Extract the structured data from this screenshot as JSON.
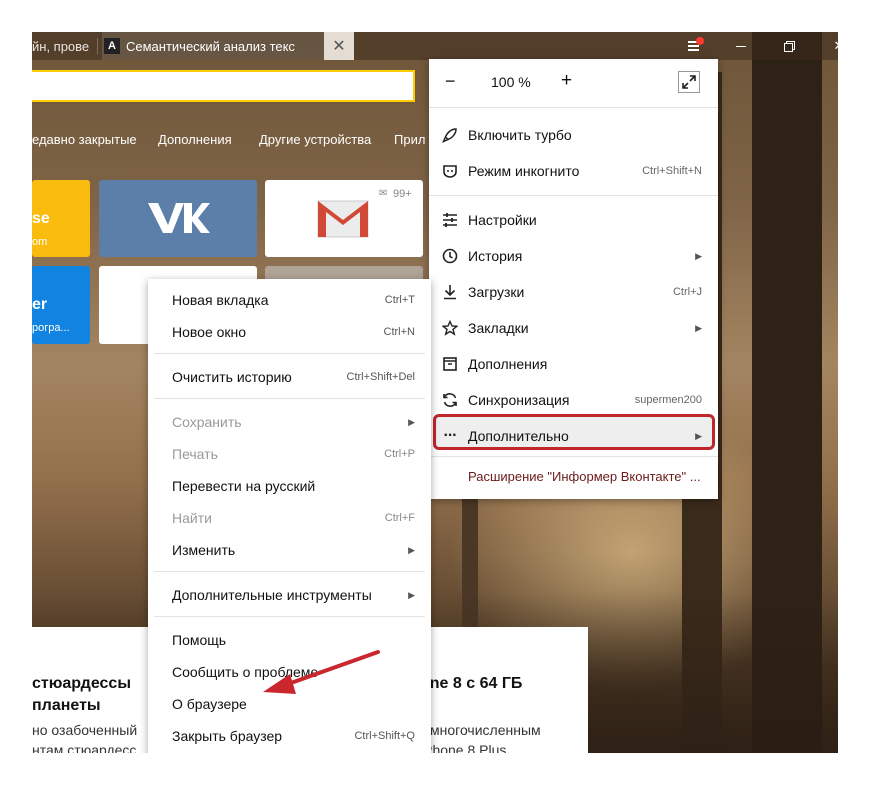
{
  "tabs": [
    {
      "title": "йн, прове"
    },
    {
      "icon_letter": "A",
      "title": "Семантический анализ текс"
    }
  ],
  "bookmarks": [
    "едавно закрытые",
    "Дополнения",
    "Другие устройства",
    "Прил"
  ],
  "tiles": {
    "yellow_title": "se",
    "yellow_sub": "om",
    "blue_title": "er",
    "blue_sub": "рогра...",
    "gmail_badge": "99+"
  },
  "news": {
    "left_heading": [
      "стюардессы",
      "планеты"
    ],
    "left_text": [
      "но озабоченный",
      "нтам стюардесс"
    ],
    "right_heading": "one 8 с 64 ГБ",
    "right_text": [
      "многочисленным",
      "iPhone 8 Plus"
    ]
  },
  "main_menu": {
    "zoom": {
      "minus": "−",
      "value": "100 %",
      "plus": "+"
    },
    "items": [
      {
        "label": "Включить турбо",
        "shortcut": "",
        "submenu": false
      },
      {
        "label": "Режим инкогнито",
        "shortcut": "Ctrl+Shift+N",
        "submenu": false
      },
      {
        "label": "Настройки",
        "shortcut": "",
        "submenu": false
      },
      {
        "label": "История",
        "shortcut": "",
        "submenu": true
      },
      {
        "label": "Загрузки",
        "shortcut": "Ctrl+J",
        "submenu": false
      },
      {
        "label": "Закладки",
        "shortcut": "",
        "submenu": true
      },
      {
        "label": "Дополнения",
        "shortcut": "",
        "submenu": false
      },
      {
        "label": "Синхронизация",
        "shortcut": "supermen200",
        "submenu": false
      },
      {
        "label": "Дополнительно",
        "shortcut": "",
        "submenu": true
      }
    ],
    "extension": "Расширение \"Информер Вконтакте\" ..."
  },
  "context_menu": {
    "items": [
      {
        "label": "Новая вкладка",
        "shortcut": "Ctrl+T",
        "disabled": false,
        "submenu": false
      },
      {
        "label": "Новое окно",
        "shortcut": "Ctrl+N",
        "disabled": false,
        "submenu": false
      },
      {
        "label": "Очистить историю",
        "shortcut": "Ctrl+Shift+Del",
        "disabled": false,
        "submenu": false
      },
      {
        "label": "Сохранить",
        "shortcut": "",
        "disabled": true,
        "submenu": true
      },
      {
        "label": "Печать",
        "shortcut": "Ctrl+P",
        "disabled": true,
        "submenu": false
      },
      {
        "label": "Перевести на русский",
        "shortcut": "",
        "disabled": false,
        "submenu": false
      },
      {
        "label": "Найти",
        "shortcut": "Ctrl+F",
        "disabled": true,
        "submenu": false
      },
      {
        "label": "Изменить",
        "shortcut": "",
        "disabled": false,
        "submenu": true
      },
      {
        "label": "Дополнительные инструменты",
        "shortcut": "",
        "disabled": false,
        "submenu": true
      },
      {
        "label": "Помощь",
        "shortcut": "",
        "disabled": false,
        "submenu": false
      },
      {
        "label": "Сообщить о проблеме",
        "shortcut": "",
        "disabled": false,
        "submenu": false
      },
      {
        "label": "О браузере",
        "shortcut": "",
        "disabled": false,
        "submenu": false
      },
      {
        "label": "Закрыть браузер",
        "shortcut": "Ctrl+Shift+Q",
        "disabled": false,
        "submenu": false
      }
    ]
  },
  "colors": {
    "highlight": "#c0272d",
    "address_accent": "#ffcc00",
    "notification_dot": "#ff3b30"
  }
}
